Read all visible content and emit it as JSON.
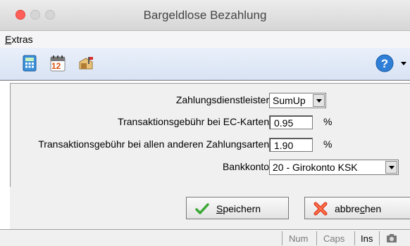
{
  "window": {
    "title": "Bargeldlose Bezahlung"
  },
  "menu": {
    "extras": {
      "underlined": "E",
      "rest": "xtras"
    }
  },
  "toolbar": {
    "icons": [
      "calculator-icon",
      "calendar-icon",
      "mailbox-icon",
      "help-icon"
    ],
    "calendar_day": "12"
  },
  "form": {
    "provider": {
      "label": "Zahlungsdienstleister:",
      "value": "SumUp"
    },
    "ec_fee": {
      "label": "Transaktionsgebühr bei EC-Karten:",
      "value": "0.95",
      "unit": "%"
    },
    "other_fee": {
      "label": "Transaktionsgebühr bei allen anderen Zahlungsarten:",
      "value": "1.90",
      "unit": "%"
    },
    "bank_account": {
      "label": "Bankkonto:",
      "value": "20 - Girokonto KSK"
    }
  },
  "buttons": {
    "save": {
      "underlined": "S",
      "rest": "peichern"
    },
    "cancel": {
      "before": "abbre",
      "underlined": "c",
      "after": "hen"
    }
  },
  "status": {
    "num": "Num",
    "caps": "Caps",
    "ins": "Ins"
  },
  "colors": {
    "close": "#ff5f57",
    "toolbar": "#dde6f5",
    "help": "#2f7fd8"
  }
}
